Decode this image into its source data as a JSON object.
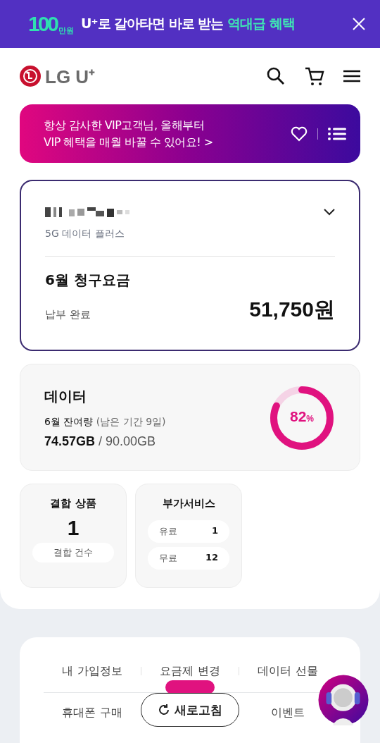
{
  "promo_banner": {
    "badge_amount": "100",
    "badge_unit": "만원",
    "text": "U⁺로 갈아타면 바로 받는 ",
    "highlight": "역대급 혜택"
  },
  "header": {
    "logo": "LG U⁺"
  },
  "vip_banner": {
    "text": "항상 감사한 VIP고객님, 올해부터\nVIP 혜택을 매월 바꿀 수 있어요! >"
  },
  "line_card": {
    "plan": "5G 데이터 플러스",
    "expanded": false,
    "bill_title": "6월 청구요금",
    "bill_status": "납부 완료",
    "bill_amount": "51,750원"
  },
  "data_card": {
    "title": "데이터",
    "remaining_label": "6월 잔여량",
    "period": "(남은 기간 9일)",
    "remaining": "74.57GB",
    "total": "/ 90.00GB",
    "percent": "82",
    "percent_unit": "%",
    "level": 0.82
  },
  "bundle_card": {
    "title": "결합 상품",
    "count": "1",
    "caption": "결합 건수"
  },
  "addon_card": {
    "title": "부가서비스",
    "rows": [
      {
        "label": "유료",
        "count": "1"
      },
      {
        "label": "무료",
        "count": "12"
      }
    ]
  },
  "menu": {
    "rows": [
      [
        {
          "label": "내 가입정보"
        },
        {
          "label": "요금제 변경"
        },
        {
          "label": "데이터 선물"
        }
      ],
      [
        {
          "label": "휴대폰 구매"
        },
        {
          "covered": true
        },
        {
          "label": "이벤트"
        }
      ]
    ]
  },
  "refresh_button": {
    "label": "새로고침"
  }
}
